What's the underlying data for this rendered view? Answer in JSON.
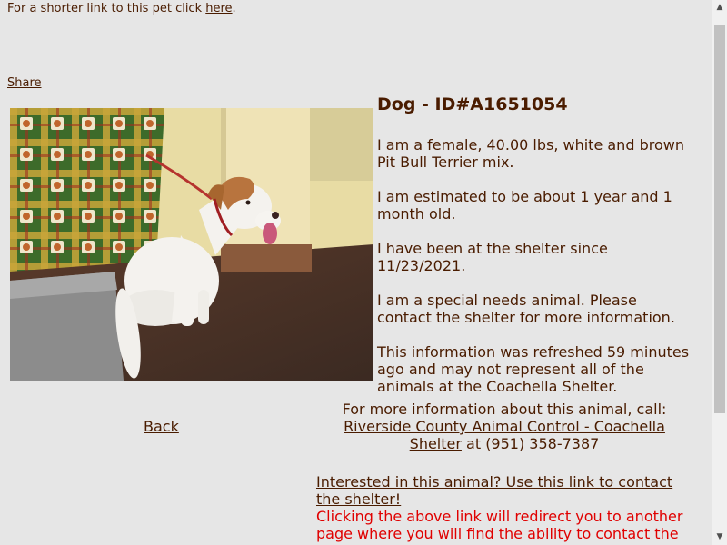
{
  "short_link": {
    "prefix": "For a shorter link to this pet click ",
    "link_text": "here",
    "suffix": "."
  },
  "share_label": "Share",
  "pet": {
    "title": "Dog - ID#A1651054",
    "paragraphs": [
      "I am a female, 40.00 lbs, white and brown Pit Bull Terrier mix.",
      "I am estimated to be about 1 year and 1 month old.",
      "I have been at the shelter since 11/23/2021.",
      "I am a special needs animal. Please contact the shelter for more information.",
      "This information was refreshed 59 minutes ago and may not represent all of the animals at the Coachella Shelter."
    ]
  },
  "back_label": "Back",
  "contact": {
    "intro": "For more information about this animal, call:",
    "shelter_link": "Riverside County Animal Control - Coachella Shelter",
    "phone_text": " at (951) 358-7387"
  },
  "interest": {
    "link_text": "Interested in this animal? Use this link to contact the shelter!",
    "redirect_note": "Clicking the above link will redirect you to another page where you will find the ability to contact the shelter."
  }
}
